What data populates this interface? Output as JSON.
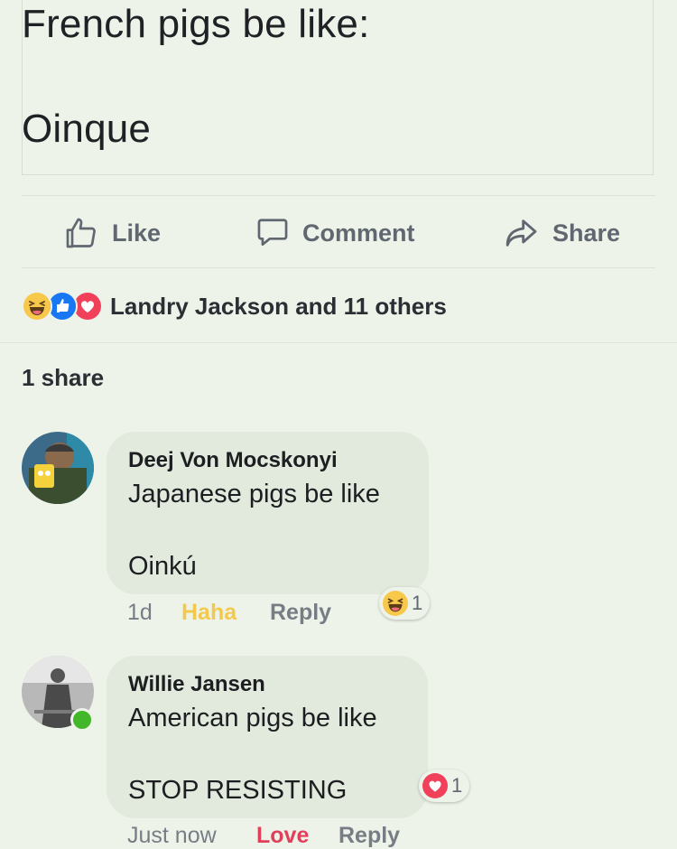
{
  "post": {
    "line1": "French pigs be like:",
    "line2": "Oinque"
  },
  "actions": {
    "like": "Like",
    "comment": "Comment",
    "share": "Share"
  },
  "reactions": {
    "icons": [
      "haha-icon",
      "like-icon",
      "love-icon"
    ],
    "summary": "Landry Jackson and 11 others"
  },
  "shares": "1 share",
  "comments": [
    {
      "name": "Deej Von Mocskonyi",
      "line1": "Japanese pigs be like",
      "line2": "Oinkú",
      "time": "1d",
      "my_reaction": "Haha",
      "reply": "Reply",
      "reaction_icon": "haha-icon",
      "reaction_count": "1"
    },
    {
      "name": "Willie Jansen",
      "line1": "American pigs be like",
      "line2": "STOP RESISTING",
      "time": "Just now",
      "my_reaction": "Love",
      "reply": "Reply",
      "reaction_icon": "love-icon",
      "reaction_count": "1"
    }
  ],
  "colors": {
    "background": "#eef3ea",
    "bubble": "#e2e9dd",
    "haha": "#f2c94c",
    "love": "#e0405a",
    "like": "#1877f2",
    "online": "#42b72a"
  }
}
